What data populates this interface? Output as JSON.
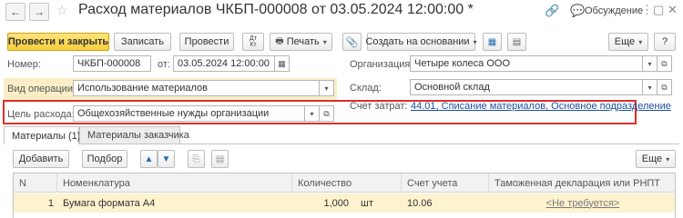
{
  "window": {
    "title": "Расход материалов ЧКБП-000008 от 03.05.2024 12:00:00 *",
    "discussion_label": "Обсуждение"
  },
  "toolbar": {
    "post_and_close": "Провести и закрыть",
    "save": "Записать",
    "post": "Провести",
    "dt_kt": "Дт/кт",
    "print": "Печать",
    "create_based_on": "Создать на основании",
    "more": "Еще"
  },
  "form": {
    "number_label": "Номер:",
    "number_value": "ЧКБП-000008",
    "date_label": "от:",
    "date_value": "03.05.2024 12:00:00",
    "organization_label": "Организация:",
    "organization_value": "Четыре колеса ООО",
    "operation_label": "Вид операции:",
    "operation_value": "Использование материалов",
    "warehouse_label": "Склад:",
    "warehouse_value": "Основной склад",
    "purpose_label": "Цель расхода:",
    "purpose_value": "Общехозяйственные нужды организации",
    "cost_account_label": "Счет затрат:",
    "cost_account_value": "44.01, Списание материалов, Основное подразделение"
  },
  "tabs": [
    {
      "label": "Материалы (1)",
      "active": true
    },
    {
      "label": "Материалы заказчика",
      "active": false
    }
  ],
  "table_toolbar": {
    "add": "Добавить",
    "select": "Подбор",
    "more": "Еще"
  },
  "table": {
    "columns": [
      "N",
      "Номенклатура",
      "Количество",
      "Счет учета",
      "Таможенная декларация или РНПТ"
    ],
    "rows": [
      {
        "n": "1",
        "item": "Бумага формата А4",
        "quantity": "1,000",
        "unit": "шт",
        "account": "10.06",
        "customs": "<Не требуется>"
      }
    ]
  },
  "colors": {
    "primary_button": "#f6cf3a",
    "highlight_border": "#d9302b",
    "operation_highlight": "#fbeec7",
    "selected_row": "#fdf3cf",
    "link": "#1c4fa1"
  }
}
